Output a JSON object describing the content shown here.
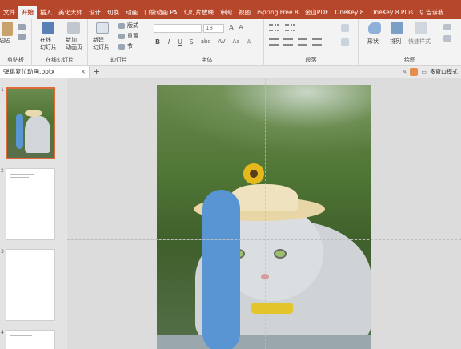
{
  "menu": {
    "tabs": [
      "文件",
      "开始",
      "插入",
      "美化大师",
      "设计",
      "切换",
      "动画",
      "口袋动画 PA",
      "幻灯片放映",
      "审阅",
      "视图",
      "iSpring Free 8",
      "金山PDF",
      "OneKey 8",
      "OneKey 8 Plus",
      "♀ 告诉我..."
    ],
    "active_index": 1
  },
  "ribbon": {
    "clipboard": {
      "label": "剪贴板",
      "paste": "粘贴"
    },
    "online_slides": {
      "label": "在线幻灯片",
      "button": "在线\n幻灯片"
    },
    "new_slide": {
      "label": "新建\n幻灯片",
      "add_anim": "新加\n动画页"
    },
    "slides": {
      "label": "幻灯片",
      "layout": "版式",
      "reset": "重置",
      "section": "节"
    },
    "font": {
      "label": "字体",
      "size": "18",
      "bold": "B",
      "italic": "I",
      "underline": "U",
      "strike": "S",
      "shadow": "abc",
      "spacing": "AV",
      "case": "Aa",
      "color": "A"
    },
    "paragraph": {
      "label": "段落"
    },
    "drawing": {
      "label": "绘图",
      "shapes": "形状",
      "arrange": "排列",
      "quick_styles": "快速样式"
    }
  },
  "file_tab": {
    "name": "弹跳复位动画.pptx",
    "close": "×",
    "add": "+"
  },
  "right_tools": {
    "multiwindow": "多窗口模式"
  },
  "thumbnails": [
    {
      "number": "1",
      "selected": true
    },
    {
      "number": "2",
      "selected": false
    },
    {
      "number": "3",
      "selected": false
    },
    {
      "number": "4",
      "selected": false
    }
  ],
  "colors": {
    "accent": "#b7472a",
    "shape_fill": "#5a95d3",
    "selection": "#e06b3a"
  }
}
